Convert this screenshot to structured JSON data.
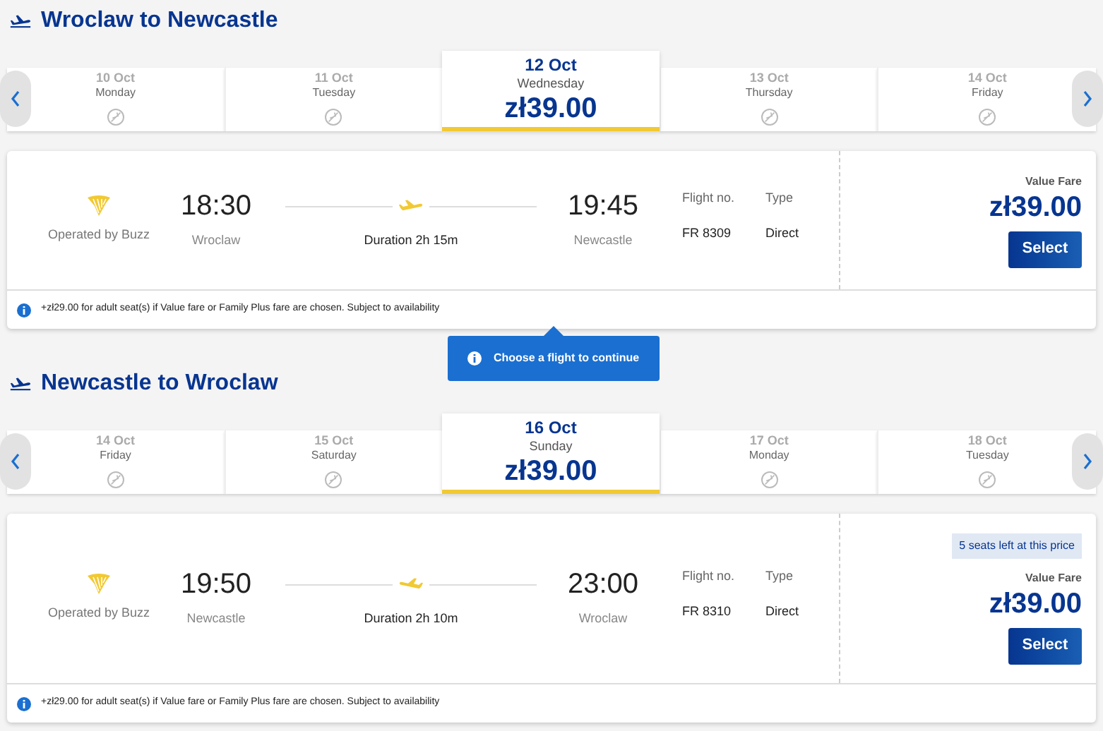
{
  "journeys": [
    {
      "title": "Wroclaw to Newcastle",
      "dates": [
        {
          "date": "10 Oct",
          "day": "Monday",
          "selected": false
        },
        {
          "date": "11 Oct",
          "day": "Tuesday",
          "selected": false
        },
        {
          "date": "12 Oct",
          "day": "Wednesday",
          "selected": true,
          "price": "zł39.00"
        },
        {
          "date": "13 Oct",
          "day": "Thursday",
          "selected": false
        },
        {
          "date": "14 Oct",
          "day": "Friday",
          "selected": false
        }
      ],
      "flight": {
        "operator": "Operated by Buzz",
        "dep_time": "18:30",
        "dep_city": "Wroclaw",
        "duration": "Duration 2h 15m",
        "plane_flipped": false,
        "arr_time": "19:45",
        "arr_city": "Newcastle",
        "flight_no_label": "Flight no.",
        "flight_no": "FR 8309",
        "type_label": "Type",
        "type": "Direct",
        "fare_label": "Value Fare",
        "price": "zł39.00",
        "button": "Select",
        "info": "+zł29.00 for adult seat(s) if Value fare or Family Plus fare are chosen. Subject to availability"
      },
      "tooltip": "Choose a flight to continue"
    },
    {
      "title": "Newcastle to Wroclaw",
      "dates": [
        {
          "date": "14 Oct",
          "day": "Friday",
          "selected": false
        },
        {
          "date": "15 Oct",
          "day": "Saturday",
          "selected": false
        },
        {
          "date": "16 Oct",
          "day": "Sunday",
          "selected": true,
          "price": "zł39.00"
        },
        {
          "date": "17 Oct",
          "day": "Monday",
          "selected": false
        },
        {
          "date": "18 Oct",
          "day": "Tuesday",
          "selected": false
        }
      ],
      "flight": {
        "operator": "Operated by Buzz",
        "dep_time": "19:50",
        "dep_city": "Newcastle",
        "duration": "Duration 2h 10m",
        "plane_flipped": true,
        "arr_time": "23:00",
        "arr_city": "Wroclaw",
        "flight_no_label": "Flight no.",
        "flight_no": "FR 8310",
        "type_label": "Type",
        "type": "Direct",
        "seats_badge": "5 seats left at this price",
        "fare_label": "Value Fare",
        "price": "zł39.00",
        "button": "Select",
        "info": "+zł29.00 for adult seat(s) if Value fare or Family Plus fare are chosen. Subject to availability"
      }
    }
  ]
}
